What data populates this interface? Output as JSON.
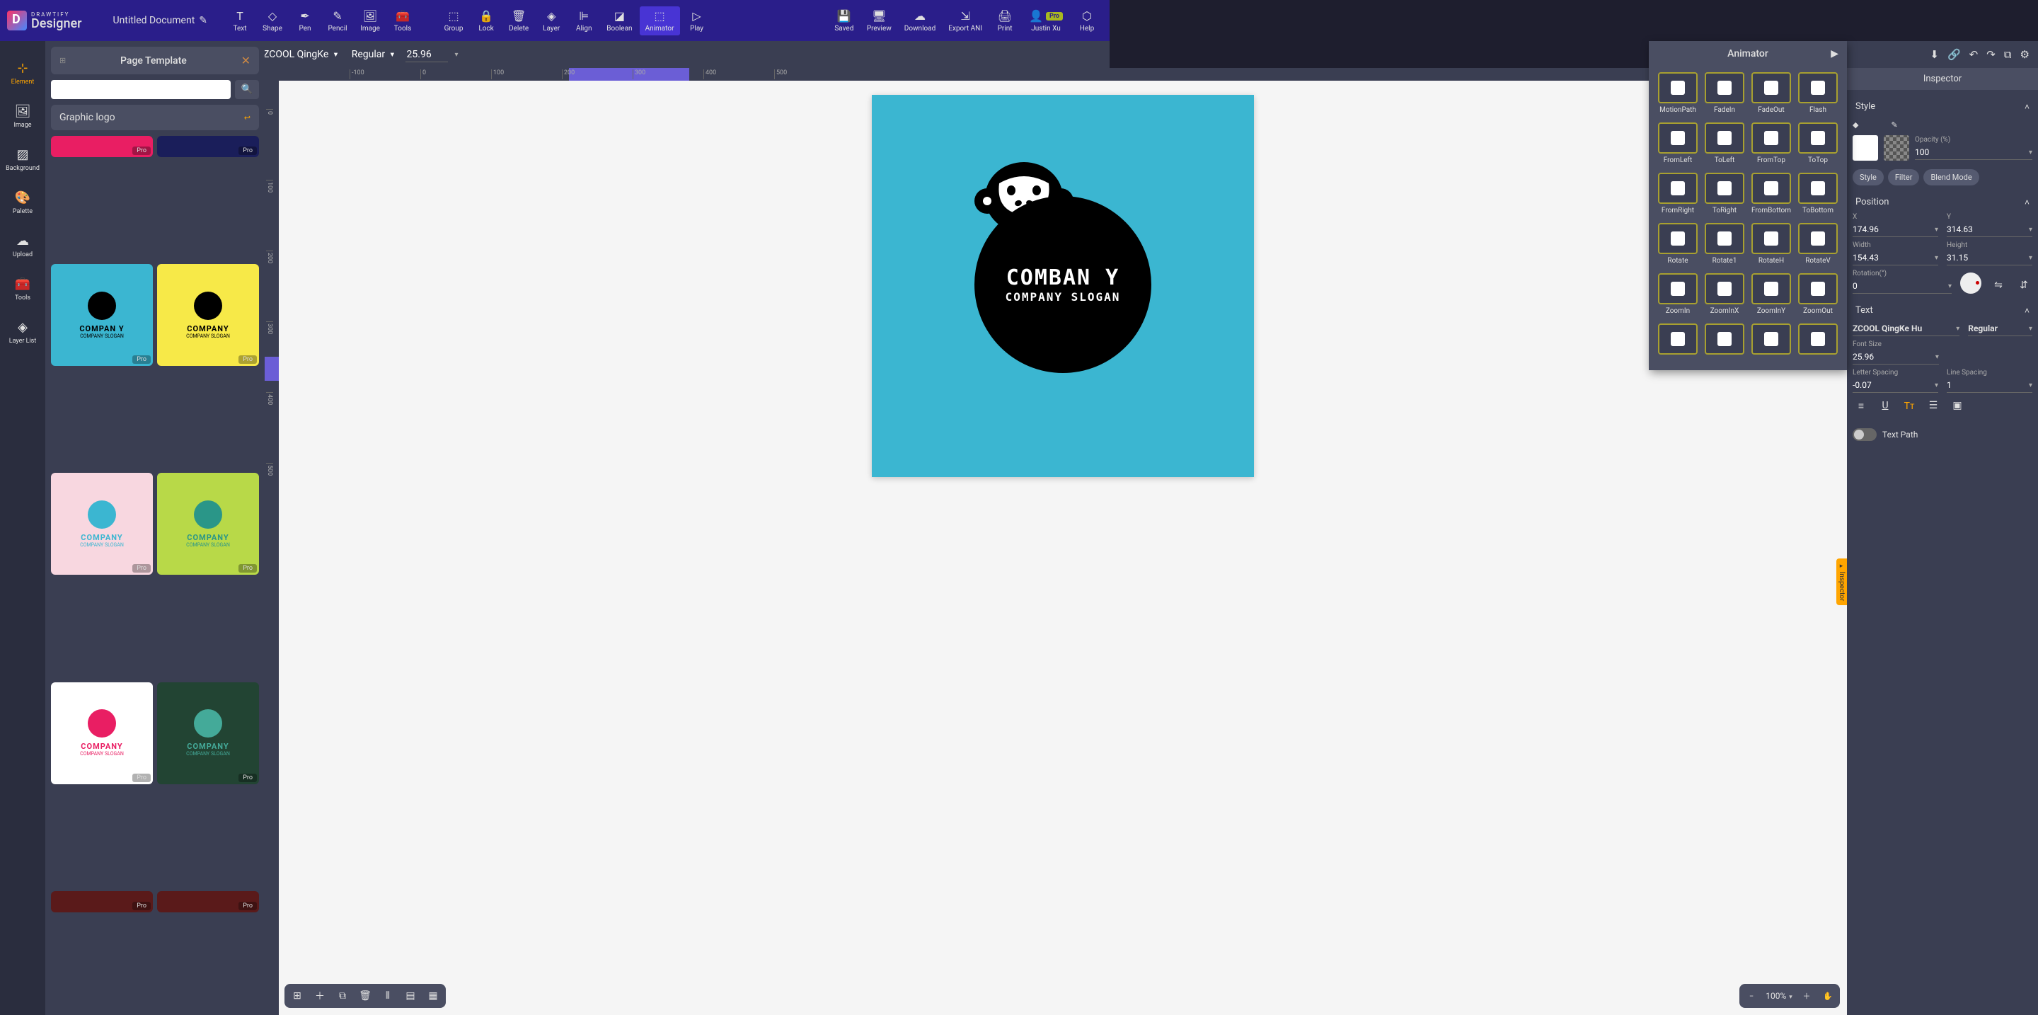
{
  "app": {
    "brand_small": "DRAWTIFY",
    "brand_big": "Designer",
    "doc_title": "Untitled Document"
  },
  "user": {
    "name": "Justin Xu",
    "badge": "Pro"
  },
  "top_menu": {
    "left": [
      {
        "id": "text",
        "label": "Text"
      },
      {
        "id": "shape",
        "label": "Shape"
      },
      {
        "id": "pen",
        "label": "Pen"
      },
      {
        "id": "pencil",
        "label": "Pencil"
      },
      {
        "id": "image",
        "label": "Image"
      },
      {
        "id": "tools",
        "label": "Tools"
      }
    ],
    "mid": [
      {
        "id": "group",
        "label": "Group"
      },
      {
        "id": "lock",
        "label": "Lock"
      },
      {
        "id": "delete",
        "label": "Delete"
      },
      {
        "id": "layer",
        "label": "Layer"
      },
      {
        "id": "align",
        "label": "Align"
      },
      {
        "id": "boolean",
        "label": "Boolean"
      },
      {
        "id": "animator",
        "label": "Animator",
        "active": true
      },
      {
        "id": "play",
        "label": "Play"
      }
    ],
    "right": [
      {
        "id": "saved",
        "label": "Saved"
      },
      {
        "id": "preview",
        "label": "Preview"
      },
      {
        "id": "download",
        "label": "Download"
      },
      {
        "id": "export",
        "label": "Export ANI"
      },
      {
        "id": "print",
        "label": "Print"
      }
    ],
    "help": "Help"
  },
  "toolbar": {
    "font": "ZCOOL QingKe",
    "weight": "Regular",
    "size": "25.96"
  },
  "left_rail": [
    {
      "id": "element",
      "label": "Element",
      "active": true
    },
    {
      "id": "image",
      "label": "Image"
    },
    {
      "id": "background",
      "label": "Background"
    },
    {
      "id": "palette",
      "label": "Palette"
    },
    {
      "id": "upload",
      "label": "Upload"
    },
    {
      "id": "tools",
      "label": "Tools"
    },
    {
      "id": "layerlist",
      "label": "Layer List"
    }
  ],
  "left_panel": {
    "title": "Page Template",
    "sub": "Graphic logo",
    "search_placeholder": "",
    "pro_tag": "Pro",
    "cards": [
      {
        "bg": "#e91e63",
        "h": 30
      },
      {
        "bg": "#1a1e5a",
        "h": 30
      },
      {
        "bg": "#3bb6d1",
        "label": "COMPAN Y",
        "sub": "COMPANY SLOGAN"
      },
      {
        "bg": "#f7e948",
        "label": "COMPANY",
        "sub": "COMPANY SLOGAN"
      },
      {
        "bg": "#f8d7e0",
        "label": "COMPANY",
        "sub": "COMPANY SLOGAN",
        "accent": "#3bb6d1"
      },
      {
        "bg": "#b8d948",
        "label": "COMPANY",
        "sub": "COMPANY SLOGAN",
        "accent": "#2a9688"
      },
      {
        "bg": "#ffffff",
        "label": "COMPANY",
        "sub": "COMPANY SLOGAN",
        "accent": "#e91e63"
      },
      {
        "bg": "#224433",
        "label": "COMPANY",
        "sub": "COMPANY SLOGAN",
        "accent": "#4a9"
      },
      {
        "bg": "#5a1a1a",
        "h": 30
      },
      {
        "bg": "#5a1a1a",
        "h": 30
      }
    ]
  },
  "canvas": {
    "company": "COMBAN Y",
    "slogan": "COMPANY SLOGAN",
    "ruler_h": [
      -100,
      0,
      100,
      200,
      300,
      400,
      500
    ],
    "ruler_v": [
      0,
      100,
      200,
      300,
      400,
      500
    ],
    "zoom": "100%"
  },
  "animator": {
    "title": "Animator",
    "items": [
      "MotionPath",
      "FadeIn",
      "FadeOut",
      "Flash",
      "FromLeft",
      "ToLeft",
      "FromTop",
      "ToTop",
      "FromRight",
      "ToRight",
      "FromBottom",
      "ToBottom",
      "Rotate",
      "Rotate1",
      "RotateH",
      "RotateV",
      "ZoomIn",
      "ZoomInX",
      "ZoomInY",
      "ZoomOut",
      "",
      "",
      "",
      ""
    ]
  },
  "inspector": {
    "title": "Inspector",
    "style_label": "Style",
    "opacity_label": "Opacity (%)",
    "opacity": "100",
    "pills": [
      "Style",
      "Filter",
      "Blend Mode"
    ],
    "position_label": "Position",
    "x_label": "X",
    "x": "174.96",
    "y_label": "Y",
    "y": "314.63",
    "w_label": "Width",
    "w": "154.43",
    "h_label": "Height",
    "h": "31.15",
    "rot_label": "Rotation(°)",
    "rot": "0",
    "text_label": "Text",
    "font": "ZCOOL QingKe Hu",
    "weight": "Regular",
    "fsize_label": "Font Size",
    "fsize": "25.96",
    "letter_label": "Letter Spacing",
    "letter": "-0.07",
    "line_label": "Line Spacing",
    "line": "1",
    "textpath": "Text Path",
    "tab": "Inspector"
  }
}
